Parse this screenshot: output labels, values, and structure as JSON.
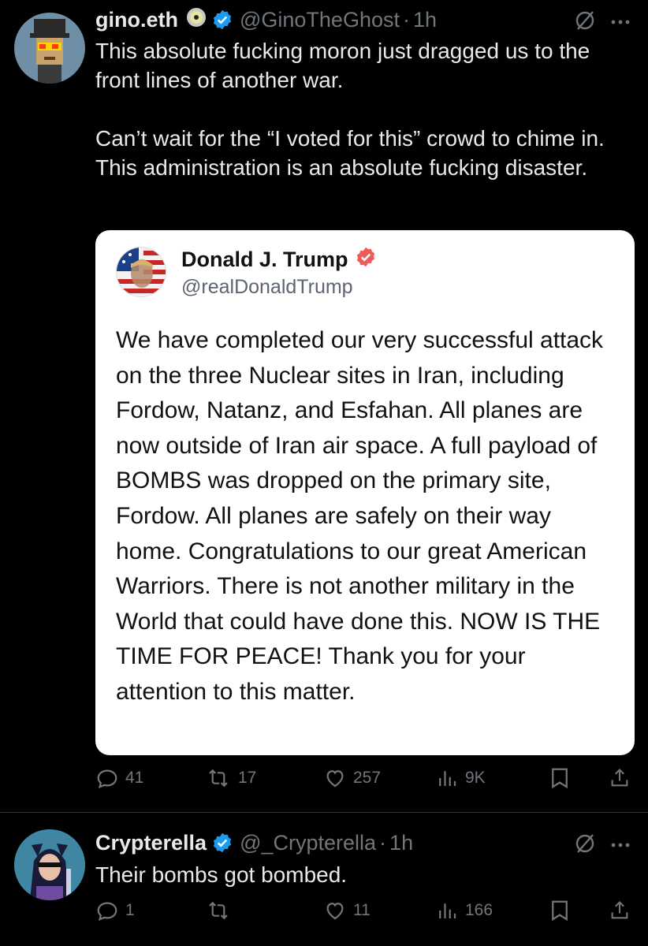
{
  "tweet1": {
    "name": "gino.eth",
    "handle": "@GinoTheGhost",
    "sep": "·",
    "time": "1h",
    "paragraphs": [
      "This absolute fucking moron just dragged us to the front lines of another war.",
      "Can’t wait for the “I voted for this” crowd to chime in. This administration is an absolute fucking disaster."
    ],
    "quote": {
      "name": "Donald J. Trump",
      "handle": "@realDonaldTrump",
      "text": "We have completed our very successful attack on the three Nuclear sites in Iran, including Fordow, Natanz, and Esfahan. All planes are now outside of Iran air space. A full payload of BOMBS was dropped on the primary site, Fordow. All planes are safely on their way home. Congratulations to our great American Warriors. There is not another military in the World that could have done this. NOW IS THE TIME FOR PEACE! Thank you for your attention to this matter."
    },
    "actions": {
      "replies": "41",
      "reposts": "17",
      "likes": "257",
      "views": "9K"
    }
  },
  "tweet2": {
    "name": "Crypterella",
    "handle": "@_Crypterella",
    "sep": "·",
    "time": "1h",
    "text": "Their bombs got bombed.",
    "actions": {
      "replies": "1",
      "reposts": "",
      "likes": "11",
      "views": "166"
    }
  },
  "colors": {
    "background": "#000000",
    "verified": "#1d9bf0",
    "muted": "#71767b",
    "text": "#e7e9ea"
  },
  "icons": [
    "reply-icon",
    "repost-icon",
    "like-icon",
    "views-icon",
    "bookmark-icon",
    "share-icon",
    "grok-icon",
    "more-icon",
    "verified-badge",
    "cd-icon"
  ]
}
